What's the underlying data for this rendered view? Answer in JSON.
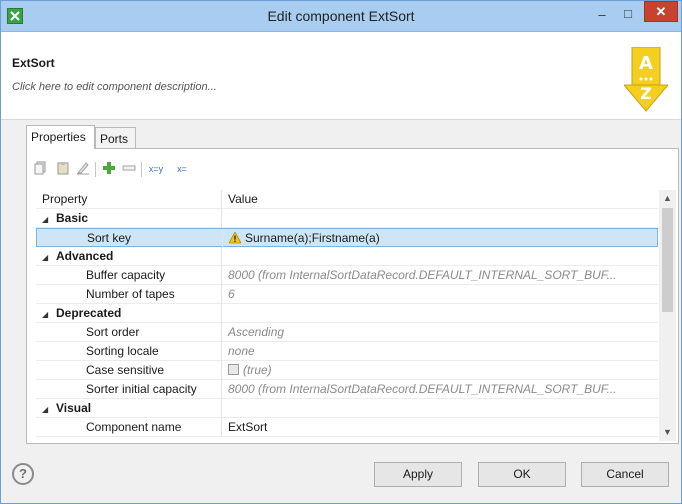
{
  "window": {
    "title": "Edit component ExtSort",
    "close_label": "✕",
    "minimize_label": "–",
    "maximize_label": "□"
  },
  "header": {
    "component_name": "ExtSort",
    "description_placeholder": "Click here to edit component description..."
  },
  "tabs": [
    {
      "label": "Properties",
      "active": true
    },
    {
      "label": "Ports",
      "active": false
    }
  ],
  "toolbar": {
    "icons": [
      "copy-icon",
      "paste-icon",
      "clear-icon",
      "add-icon",
      "remove-icon",
      "edge-to-value-icon",
      "value-to-edge-icon"
    ],
    "xy_label": "x=y",
    "xz_label": "x="
  },
  "grid": {
    "columns": [
      "Property",
      "Value"
    ],
    "rows": [
      {
        "type": "category",
        "label": "Basic"
      },
      {
        "type": "property",
        "label": "Sort key",
        "value": "Surname(a);Firstname(a)",
        "selected": true,
        "warning": true
      },
      {
        "type": "category",
        "label": "Advanced"
      },
      {
        "type": "property",
        "label": "Buffer capacity",
        "value": "8000 (from InternalSortDataRecord.DEFAULT_INTERNAL_SORT_BUF...",
        "muted": true
      },
      {
        "type": "property",
        "label": "Number of tapes",
        "value": "6",
        "muted": true
      },
      {
        "type": "category",
        "label": "Deprecated"
      },
      {
        "type": "property",
        "label": "Sort order",
        "value": "Ascending",
        "muted": true
      },
      {
        "type": "property",
        "label": "Sorting locale",
        "value": "none",
        "muted": true
      },
      {
        "type": "property",
        "label": "Case sensitive",
        "value": "(true)",
        "muted": true,
        "checkbox": true
      },
      {
        "type": "property",
        "label": "Sorter initial capacity",
        "value": "8000 (from InternalSortDataRecord.DEFAULT_INTERNAL_SORT_BUF...",
        "muted": true
      },
      {
        "type": "category",
        "label": "Visual"
      },
      {
        "type": "property",
        "label": "Component name",
        "value": "ExtSort"
      }
    ]
  },
  "buttons": {
    "apply": "Apply",
    "ok": "OK",
    "cancel": "Cancel",
    "help": "?"
  },
  "colors": {
    "titlebar": "#a9cdf0",
    "selection": "#cde6f7",
    "close": "#c7432f",
    "sort_icon": "#f4cf20"
  }
}
